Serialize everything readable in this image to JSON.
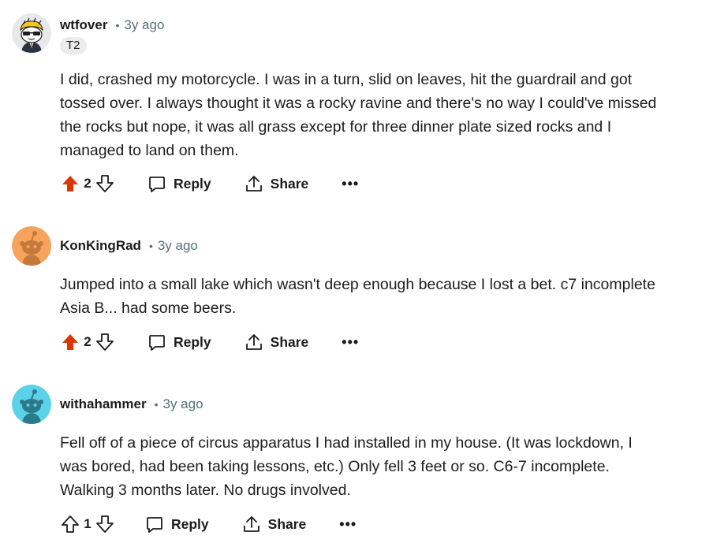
{
  "comments": [
    {
      "username": "wtfover",
      "separator": "•",
      "time": "3y ago",
      "flair": "T2",
      "lines": [
        "I did, crashed my motorcycle. I was in a turn, slid on leaves, hit the guardrail and got",
        "tossed over. I always thought it was a rocky ravine and there's no way I could've missed",
        "the rocks but nope, it was all grass except for three dinner plate sized rocks and I",
        "managed to land on them."
      ],
      "score": "2",
      "upvoted": true,
      "reply_label": "Reply",
      "share_label": "Share",
      "more_label": "•••",
      "avatar_icon": "snoo-sunglasses-avatar"
    },
    {
      "username": "KonKingRad",
      "separator": "•",
      "time": "3y ago",
      "lines": [
        "Jumped into a small lake which wasn't deep enough because I lost a bet. c7 incomplete",
        "Asia B... had some beers."
      ],
      "score": "2",
      "upvoted": true,
      "reply_label": "Reply",
      "share_label": "Share",
      "more_label": "•••",
      "avatar_icon": "snoo-orange-avatar"
    },
    {
      "username": "withahammer",
      "separator": "•",
      "time": "3y ago",
      "lines": [
        "Fell off of a piece of circus apparatus I had installed in my house. (It was lockdown, I",
        "was bored, had been taking lessons, etc.) Only fell 3 feet or so. C6-7 incomplete.",
        "Walking 3 months later. No drugs involved."
      ],
      "score": "1",
      "upvoted": false,
      "reply_label": "Reply",
      "share_label": "Share",
      "more_label": "•••",
      "avatar_icon": "snoo-teal-avatar"
    }
  ],
  "colors": {
    "upvote_active": "#d93900",
    "text": "#1c1c1c",
    "meta": "#576f76",
    "flair_bg": "#e9ebed",
    "avatar_orange_bg": "#f7a35c",
    "avatar_teal_bg": "#5bd2e9"
  }
}
